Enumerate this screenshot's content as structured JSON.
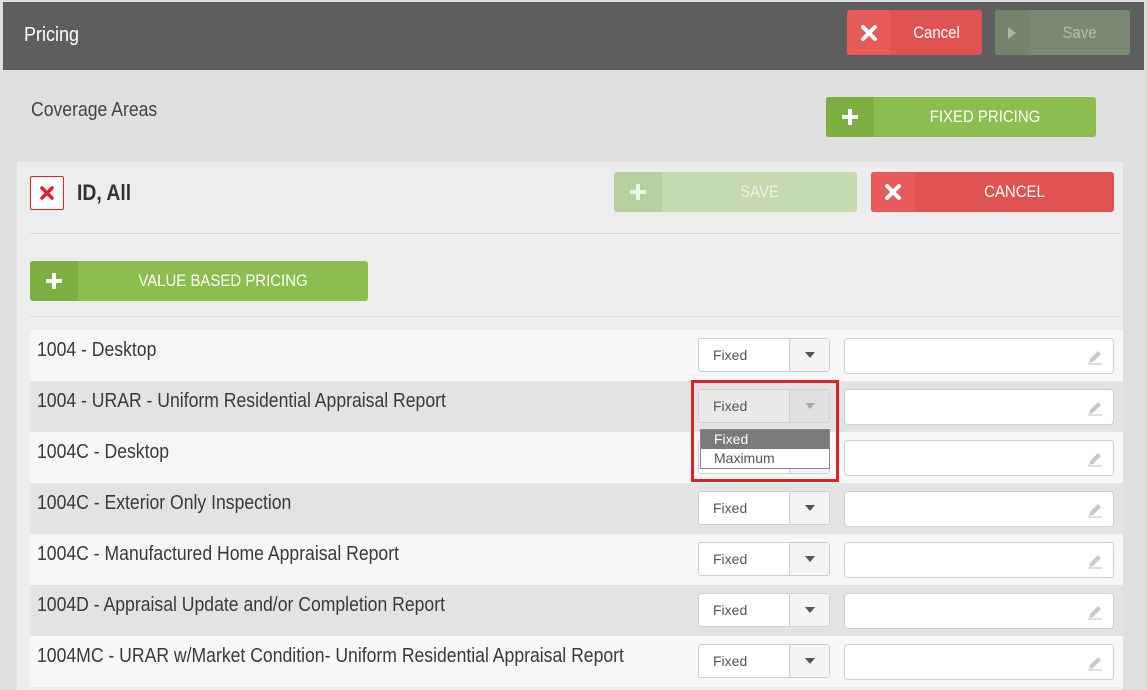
{
  "header": {
    "title": "Pricing",
    "cancel_label": "Cancel",
    "save_label": "Save"
  },
  "coverage": {
    "label": "Coverage Areas",
    "fixed_pricing_label": "FIXED PRICING"
  },
  "section": {
    "title": "ID, All",
    "save_label": "SAVE",
    "cancel_label": "CANCEL",
    "value_pricing_label": "VALUE BASED PRICING"
  },
  "rows": [
    {
      "name": "1004 - Desktop",
      "type": "Fixed"
    },
    {
      "name": "1004 - URAR - Uniform Residential Appraisal Report",
      "type": "Fixed"
    },
    {
      "name": "1004C - Desktop",
      "type": ""
    },
    {
      "name": "1004C - Exterior Only Inspection",
      "type": "Fixed"
    },
    {
      "name": "1004C - Manufactured Home Appraisal Report",
      "type": "Fixed"
    },
    {
      "name": "1004D - Appraisal Update and/or Completion Report",
      "type": "Fixed"
    },
    {
      "name": "1004MC - URAR w/Market Condition- Uniform Residential Appraisal Report",
      "type": "Fixed"
    }
  ],
  "dropdown": {
    "options": [
      "Fixed",
      "Maximum"
    ],
    "selected": "Fixed"
  },
  "colors": {
    "red": "#e05353",
    "green": "#8bbd4f",
    "header": "#5e5e5e",
    "highlight": "#d8232a"
  }
}
